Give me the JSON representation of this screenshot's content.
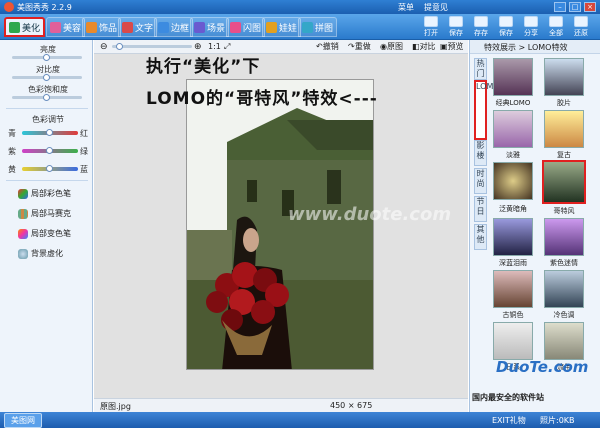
{
  "window": {
    "title": "美图秀秀 2.2.9",
    "links": [
      "菜单",
      "提意见"
    ]
  },
  "tabs": [
    {
      "label": "美化",
      "color": "#2ea84d",
      "active": true
    },
    {
      "label": "美容",
      "color": "#e0609a",
      "active": false
    },
    {
      "label": "饰品",
      "color": "#e88a2c",
      "active": false
    },
    {
      "label": "文字",
      "color": "#d94a4a",
      "active": false
    },
    {
      "label": "边框",
      "color": "#3c8be0",
      "active": false
    },
    {
      "label": "场景",
      "color": "#6a5ad0",
      "active": false
    },
    {
      "label": "闪图",
      "color": "#e84f8a",
      "active": false
    },
    {
      "label": "娃娃",
      "color": "#e2a020",
      "active": false
    },
    {
      "label": "拼图",
      "color": "#34a7c8",
      "active": false
    }
  ],
  "tools": [
    "打开",
    "保存",
    "存存",
    "保存",
    "分享",
    "全部",
    "还原"
  ],
  "left": {
    "sliders": [
      "亮度",
      "对比度",
      "色彩饱和度"
    ],
    "color_title": "色彩调节",
    "color_rows": [
      [
        "青",
        "红"
      ],
      [
        "紫",
        "绿"
      ],
      [
        "黄",
        "蓝"
      ]
    ],
    "brushes": [
      "局部彩色笔",
      "局部马赛克",
      "局部变色笔",
      "背景虚化"
    ]
  },
  "center": {
    "zoom": "1:1",
    "actions": [
      "撤销",
      "重做",
      "原图",
      "对比",
      "预览"
    ],
    "annotation_line1": "执行“美化”下",
    "annotation_line2": "LOMO的“哥特风”特效<---",
    "filename": "原图.jpg",
    "dimensions": "450 × 675",
    "watermark": "www.duote.com"
  },
  "right": {
    "header": "特效展示 > LOMO特效",
    "vtabs": [
      "热门",
      "LOMO",
      "影楼",
      "时尚",
      "节日",
      "其他"
    ],
    "effects": [
      "经典LOMO",
      "胶片",
      "淡雅",
      "复古",
      "泛黄暗角",
      "哥特风",
      "深蓝泪雨",
      "紫色迷情",
      "古铜色",
      "冷色调",
      "日系",
      "流年"
    ],
    "selected": "哥特风"
  },
  "taskbar": {
    "app": "美图网",
    "items": [
      "EXIT礼物",
      "照片:0KB"
    ]
  },
  "site": {
    "name": "DuoTe.com",
    "tag": "国内最安全的软件站"
  }
}
